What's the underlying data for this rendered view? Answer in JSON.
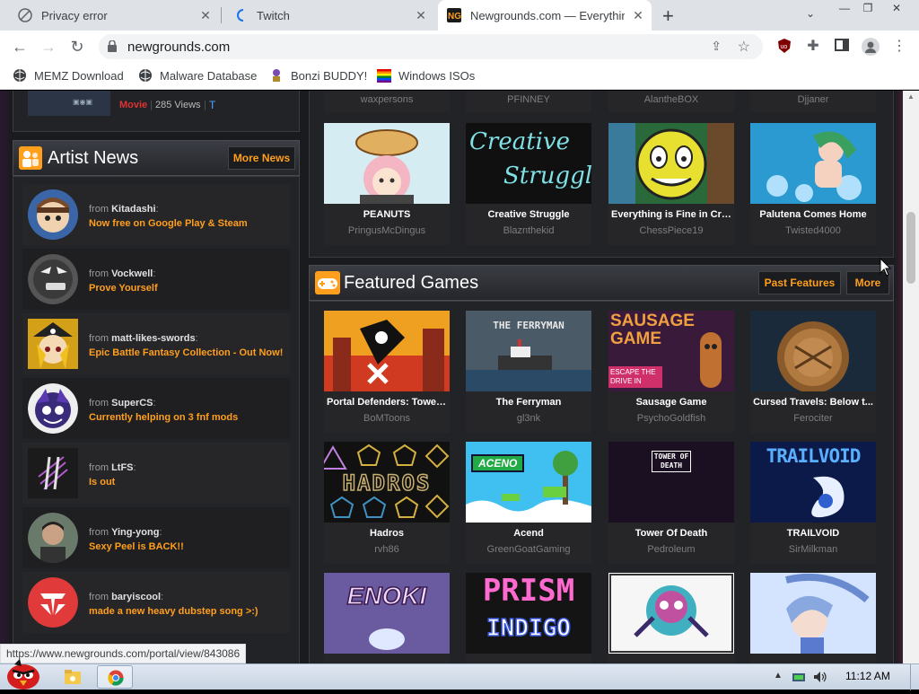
{
  "browser": {
    "tabs": [
      {
        "title": "Privacy error",
        "active": false
      },
      {
        "title": "Twitch",
        "active": false
      },
      {
        "title": "Newgrounds.com — Everythin",
        "active": true
      }
    ],
    "url": "newgrounds.com",
    "bookmarks": [
      "MEMZ Download",
      "Malware Database",
      "Bonzi BUDDY!",
      "Windows ISOs"
    ],
    "status_url": "https://www.newgrounds.com/portal/view/843086"
  },
  "top_strip": {
    "type_label": "Movie",
    "views": "285 Views",
    "extra": "T"
  },
  "artist_news": {
    "title": "Artist News",
    "more_label": "More News",
    "from_label": "from",
    "items": [
      {
        "user": "Kitadashi",
        "message": "Now free on Google Play & Steam"
      },
      {
        "user": "Vockwell",
        "message": "Prove Yourself"
      },
      {
        "user": "matt-likes-swords",
        "message": "Epic Battle Fantasy Collection - Out Now!"
      },
      {
        "user": "SuperCS",
        "message": "Currently helping on 3 fnf mods"
      },
      {
        "user": "LtFS",
        "message": "Is out"
      },
      {
        "user": "Ying-yong",
        "message": "Sexy Peel is BACK!!"
      },
      {
        "user": "baryiscool",
        "message": "made a new heavy dubstep song >:)"
      }
    ]
  },
  "movies_top_authors": [
    "waxpersons",
    "PFINNEY",
    "AlantheBOX",
    "Djjaner"
  ],
  "movies_row": [
    {
      "title": "PEANUTS",
      "author": "PringusMcDingus"
    },
    {
      "title": "Creative Struggle",
      "author": "Blaznthekid"
    },
    {
      "title": "Everything is Fine in Cry...",
      "author": "ChessPiece19"
    },
    {
      "title": "Palutena Comes Home",
      "author": "Twisted4000"
    }
  ],
  "featured_games": {
    "title": "Featured Games",
    "past_label": "Past Features",
    "more_label": "More",
    "rows": [
      [
        {
          "title": "Portal Defenders: Tower ...",
          "author": "BoMToons"
        },
        {
          "title": "The Ferryman",
          "author": "gl3nk"
        },
        {
          "title": "Sausage Game",
          "author": "PsychoGoldfish"
        },
        {
          "title": "Cursed Travels: Below t...",
          "author": "Ferociter"
        }
      ],
      [
        {
          "title": "Hadros",
          "author": "rvh86"
        },
        {
          "title": "Acend",
          "author": "GreenGoatGaming"
        },
        {
          "title": "Tower Of Death",
          "author": "Pedroleum"
        },
        {
          "title": "TRAILVOID",
          "author": "SirMilkman"
        }
      ]
    ],
    "thumb_texts": {
      "ferryman": "THE FERRYMAN",
      "sausage": "SAUSAGE GAME",
      "sausage_sub": "ESCAPE THE DRIVE IN",
      "hadros": "HADROS",
      "acend": "ACENO",
      "tower": "TOWER OF DEATH",
      "trailvoid": "TRAILVOID",
      "enoki": "ENOKI",
      "prism1": "PRISM",
      "prism2": "INDIGO",
      "creative1": "Creative",
      "creative2": "Struggle"
    }
  },
  "taskbar": {
    "time": "11:12 AM"
  },
  "colors": {
    "accent": "#ff9f1c",
    "page_bg": "#1a1b1f",
    "card_bg": "#262629"
  }
}
